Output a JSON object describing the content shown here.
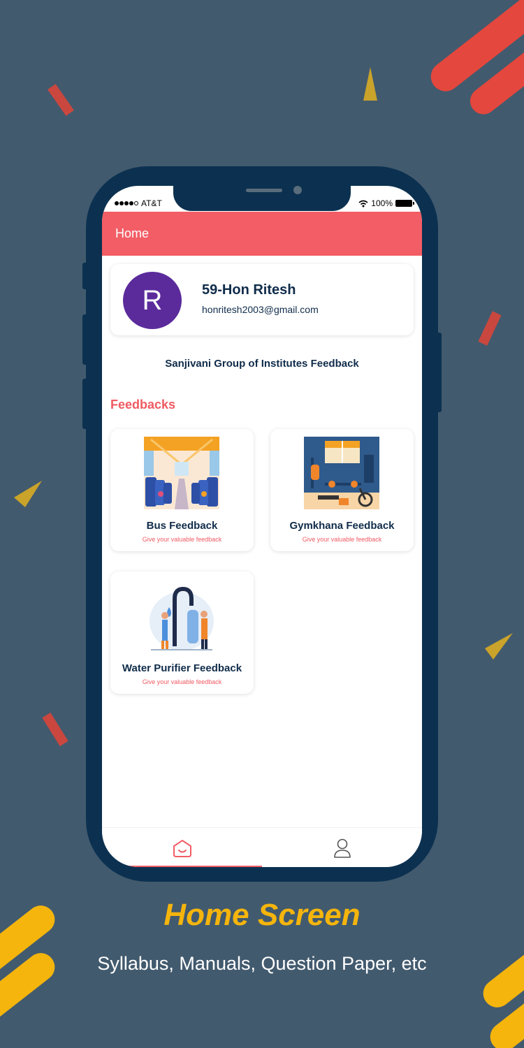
{
  "status_bar": {
    "carrier": "AT&T",
    "battery": "100%"
  },
  "appbar": {
    "title": "Home"
  },
  "profile": {
    "initial": "R",
    "name": "59-Hon Ritesh",
    "email": "honritesh2003@gmail.com"
  },
  "institute": "Sanjivani Group of Institutes Feedback",
  "section_title": "Feedbacks",
  "cards": [
    {
      "title": "Bus Feedback",
      "subtitle": "Give your valuable feedback"
    },
    {
      "title": "Gymkhana Feedback",
      "subtitle": "Give your valuable feedback"
    },
    {
      "title": "Water Purifier Feedback",
      "subtitle": "Give your valuable feedback"
    }
  ],
  "bottom_nav": {
    "items": [
      {
        "icon": "home-icon",
        "active": true
      },
      {
        "icon": "user-icon",
        "active": false
      }
    ]
  },
  "promo": {
    "title": "Home Screen",
    "subtitle": "Syllabus, Manuals, Question Paper, etc"
  },
  "colors": {
    "background": "#425a6e",
    "appbar": "#f25d66",
    "phone": "#0c3150",
    "accent_yellow": "#f5b50d",
    "avatar": "#5b2b9c"
  }
}
